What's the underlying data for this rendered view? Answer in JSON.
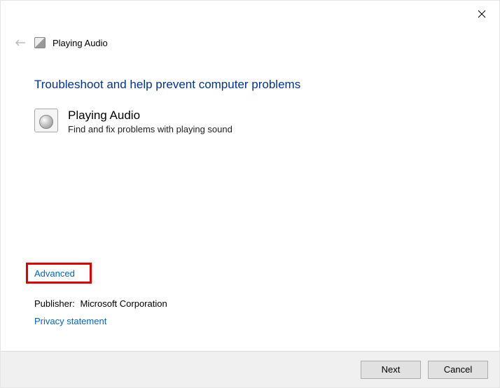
{
  "window": {
    "title": "Playing Audio"
  },
  "main": {
    "heading": "Troubleshoot and help prevent computer problems",
    "troubleshooter": {
      "title": "Playing Audio",
      "description": "Find and fix problems with playing sound"
    }
  },
  "links": {
    "advanced": "Advanced",
    "privacy": "Privacy statement"
  },
  "publisher": {
    "label": "Publisher:",
    "value": "Microsoft Corporation"
  },
  "footer": {
    "next": "Next",
    "cancel": "Cancel"
  }
}
